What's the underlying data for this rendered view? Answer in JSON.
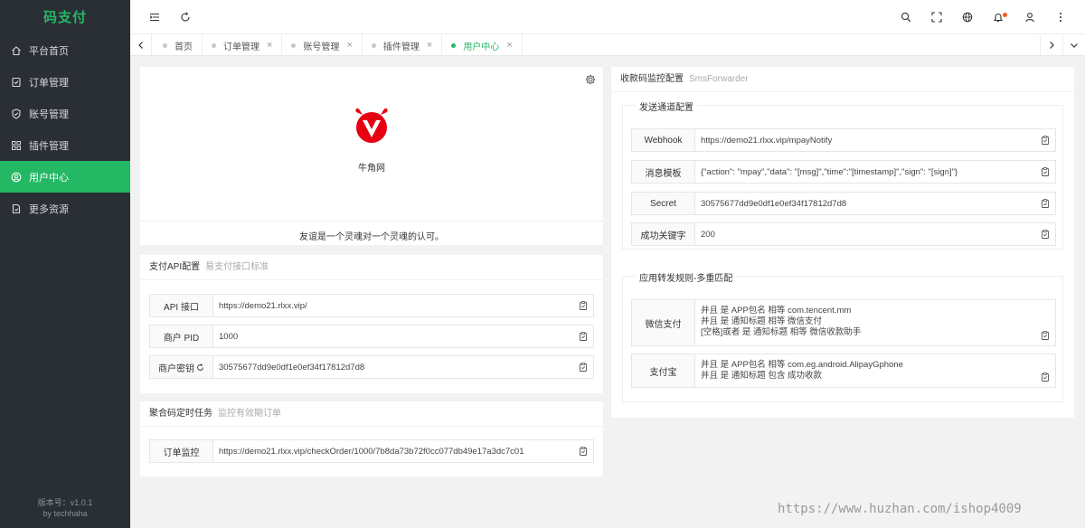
{
  "brand": "码支付",
  "sidebar": {
    "items": [
      {
        "label": "平台首页",
        "icon": "home-icon"
      },
      {
        "label": "订单管理",
        "icon": "order-icon"
      },
      {
        "label": "账号管理",
        "icon": "shield-icon"
      },
      {
        "label": "插件管理",
        "icon": "grid-icon"
      },
      {
        "label": "用户中心",
        "icon": "user-circle-icon",
        "active": true
      },
      {
        "label": "更多资源",
        "icon": "document-icon"
      }
    ],
    "version": "版本号：v1.0.1",
    "author": "by techhaha"
  },
  "header": {
    "icons": [
      "menu-fold-icon",
      "refresh-icon",
      "search-icon",
      "fullscreen-icon",
      "globe-icon",
      "bell-icon",
      "user-icon",
      "more-vertical-icon"
    ]
  },
  "tabs": [
    {
      "label": "首页",
      "closable": false
    },
    {
      "label": "订单管理",
      "closable": true
    },
    {
      "label": "账号管理",
      "closable": true
    },
    {
      "label": "插件管理",
      "closable": true
    },
    {
      "label": "用户中心",
      "closable": true,
      "active": true
    }
  ],
  "tab_close_glyph": "×",
  "profile": {
    "site_name": "牛角网",
    "motto": "友谊是一个灵魂对一个灵魂的认可。"
  },
  "api_config": {
    "title": "支付API配置",
    "subtitle": "易支付接口标准",
    "rows": [
      {
        "label": "API 接口",
        "value": "https://demo21.rlxx.vip/"
      },
      {
        "label": "商户 PID",
        "value": "1000"
      },
      {
        "label": "商户密钥",
        "value": "30575677dd9e0df1e0ef34f17812d7d8"
      }
    ]
  },
  "task": {
    "title": "聚合码定时任务",
    "subtitle": "监控有效期订单",
    "rows": [
      {
        "label": "订单监控",
        "value": "https://demo21.rlxx.vip/checkOrder/1000/7b8da73b72f0cc077db49e17a3dc7c01"
      }
    ]
  },
  "sms": {
    "title": "收款码监控配置",
    "subtitle": "SmsForwarder",
    "send_section": "发送通道配置",
    "send_rows": [
      {
        "label": "Webhook",
        "value": "https://demo21.rlxx.vip/mpayNotify"
      },
      {
        "label": "消息模板",
        "value": "{\"action\": \"mpay\",\"data\": \"[msg]\",\"time\":\"[timestamp]\",\"sign\": \"[sign]\"}"
      },
      {
        "label": "Secret",
        "value": "30575677dd9e0df1e0ef34f17812d7d8"
      },
      {
        "label": "成功关键字",
        "value": "200"
      }
    ],
    "rule_section": "应用转发规则-多重匹配",
    "rules": [
      {
        "label": "微信支付",
        "lines": [
          "并且 是 APP包名 相等 com.tencent.mm",
          "并且 是 通知标题 相等 微信支付",
          "[空格]或者 是 通知标题 相等 微信收款助手"
        ]
      },
      {
        "label": "支付宝",
        "lines": [
          "并且 是 APP包名 相等 com.eg.android.AlipayGphone",
          "并且 是 通知标题 包含 成功收款"
        ]
      }
    ]
  },
  "watermark": "https://www.huzhan.com/ishop4009",
  "colors": {
    "accent": "#25b864",
    "sidebar_bg": "#2a2f36",
    "logo_red": "#e60012"
  }
}
